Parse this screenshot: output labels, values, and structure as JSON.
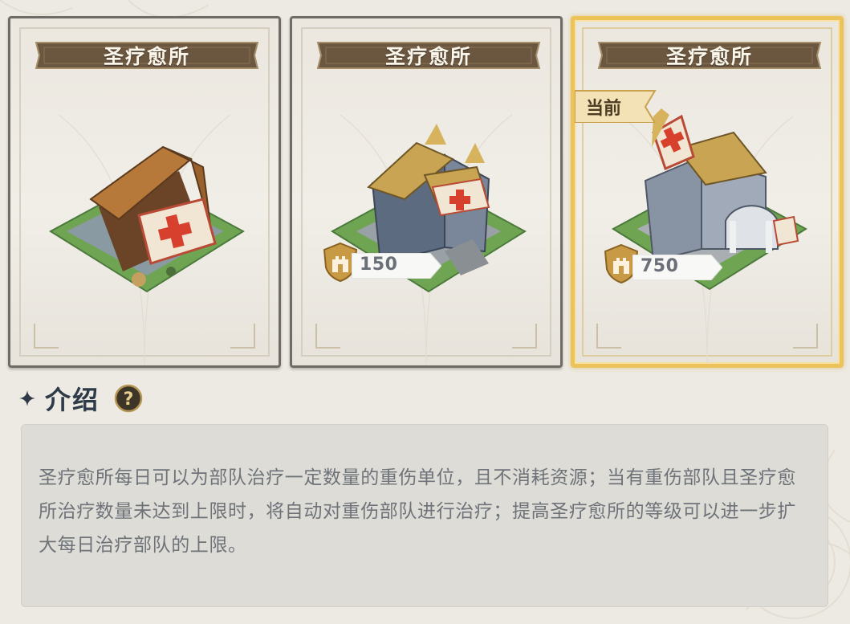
{
  "cards": [
    {
      "title": "圣疗愈所",
      "price": null,
      "current": false,
      "tag": null
    },
    {
      "title": "圣疗愈所",
      "price": "150",
      "current": false,
      "tag": null
    },
    {
      "title": "圣疗愈所",
      "price": "750",
      "current": true,
      "tag": "当前"
    }
  ],
  "intro": {
    "title": "介绍",
    "help_glyph": "?",
    "description": "圣疗愈所每日可以为部队治疗一定数量的重伤单位，且不消耗资源；当有重伤部队且圣疗愈所治疗数量未达到上限时，将自动对重伤部队进行治疗；提高圣疗愈所的等级可以进一步扩大每日治疗部队的上限。"
  },
  "icons": {
    "price_icon": "castle-shield-icon",
    "help_icon": "question-mark-icon",
    "bullet_icon": "diamond-star-icon"
  },
  "colors": {
    "banner": "#6b5640",
    "current_border": "#ecc35a",
    "text_dark": "#2f3a48",
    "desc_text": "#6e7379",
    "shield": "#c99a45"
  }
}
